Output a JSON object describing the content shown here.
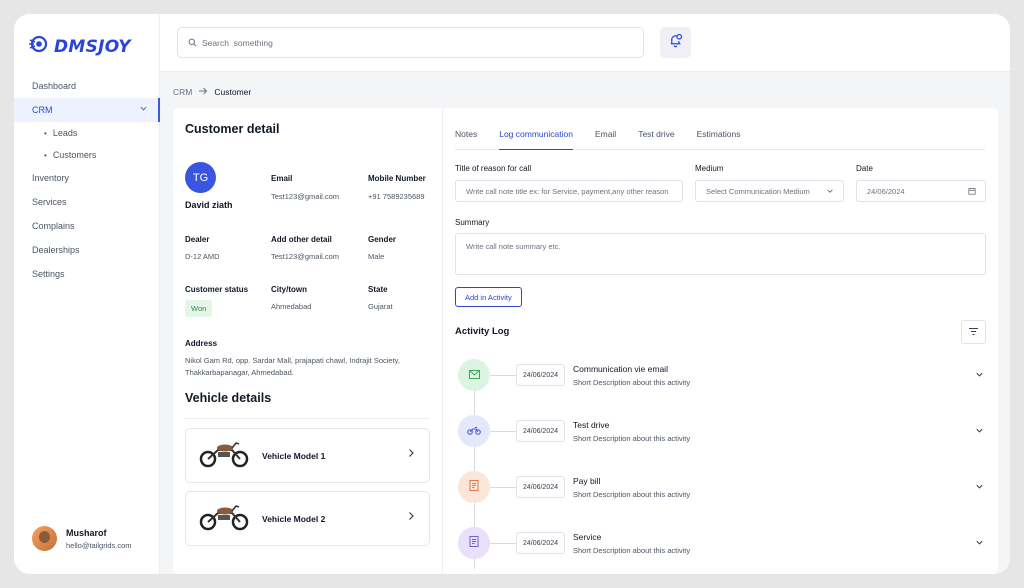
{
  "app": {
    "logo_text": "DMSJOY",
    "brand_color": "#2946d6"
  },
  "sidebar": {
    "items": [
      {
        "label": "Dashboard"
      },
      {
        "label": "CRM",
        "active": true,
        "expanded": true
      },
      {
        "label": "Inventory"
      },
      {
        "label": "Services"
      },
      {
        "label": "Complains"
      },
      {
        "label": "Dealerships"
      },
      {
        "label": "Settings"
      }
    ],
    "crm_sub": [
      {
        "label": "Leads"
      },
      {
        "label": "Customers"
      }
    ],
    "user": {
      "name": "Musharof",
      "email": "hello@tailgrids.com"
    }
  },
  "topbar": {
    "search_placeholder": "Search  something"
  },
  "breadcrumb": {
    "root": "CRM",
    "current": "Customer"
  },
  "customer": {
    "title": "Customer detail",
    "initials": "TG",
    "name": "David ziath",
    "email_label": "Email",
    "email": "Test123@gmail.com",
    "mobile_label": "Mobile Number",
    "mobile": "+91 7589235689",
    "dealer_label": "Dealer",
    "dealer": "D-12 AMD",
    "other_label": "Add other detail",
    "other": "Test123@gmail.com",
    "gender_label": "Gender",
    "gender": "Male",
    "status_label": "Customer status",
    "status": "Won",
    "city_label": "City/town",
    "city": "Ahmedabad",
    "state_label": "State",
    "state": "Gujarat",
    "address_label": "Address",
    "address_line1": "Nikol Gam Rd, opp. Sardar Mall, prajapati chawl, Indrajit Society,",
    "address_line2": "Thakkarbapanagar, Ahmedabad."
  },
  "vehicles": {
    "title": "Vehicle details",
    "items": [
      {
        "name": "Vehicle Model 1"
      },
      {
        "name": "Vehicle Model 2"
      }
    ]
  },
  "tabs": [
    {
      "label": "Notes"
    },
    {
      "label": "Log communication",
      "active": true
    },
    {
      "label": "Email"
    },
    {
      "label": "Test drive"
    },
    {
      "label": "Estimations"
    }
  ],
  "form": {
    "title_label": "Title of reason for call",
    "title_placeholder": "Write call note title ex: for Service, payment,any other reason",
    "medium_label": "Medium",
    "medium_value": "Select Communication Medium",
    "date_label": "Date",
    "date_value": "24/06/2024",
    "summary_label": "Summary",
    "summary_placeholder": "Write call note summary etc.",
    "add_button": "Add in Activity"
  },
  "activity": {
    "title": "Activity Log",
    "items": [
      {
        "date": "24/06/2024",
        "title": "Communication vie email",
        "desc": "Short Description about this activity",
        "icon": "mail-icon",
        "color": "#dcf5e3",
        "icon_color": "#3aa65a"
      },
      {
        "date": "24/06/2024",
        "title": "Test drive",
        "desc": "Short Description about this activity",
        "icon": "bike-icon",
        "color": "#e3e8fb",
        "icon_color": "#3a55e0"
      },
      {
        "date": "24/06/2024",
        "title": "Pay bill",
        "desc": "Short Description about this activity",
        "icon": "bill-icon",
        "color": "#fbe4d8",
        "icon_color": "#e07a44"
      },
      {
        "date": "24/06/2024",
        "title": "Service",
        "desc": "Short Description about this activity",
        "icon": "receipt-icon",
        "color": "#e8e1f9",
        "icon_color": "#7b5ad8"
      }
    ]
  }
}
